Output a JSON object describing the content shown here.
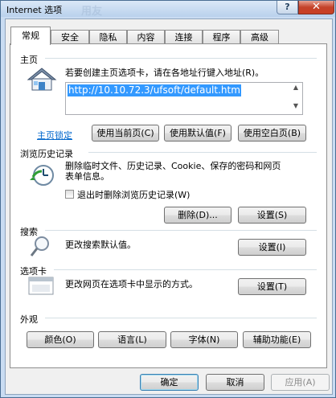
{
  "window": {
    "title": "Internet 选项",
    "ghost_logo": "用友"
  },
  "tabs": [
    "常规",
    "安全",
    "隐私",
    "内容",
    "连接",
    "程序",
    "高级"
  ],
  "homepage": {
    "title": "主页",
    "description": "若要创建主页选项卡，请在各地址行键入地址(R)。",
    "url": "http://10.10.72.3/ufsoft/default.htm",
    "lock_link": "主页锁定",
    "use_current": "使用当前页(C)",
    "use_default": "使用默认值(F)",
    "use_blank": "使用空白页(B)"
  },
  "history": {
    "title": "浏览历史记录",
    "description": "删除临时文件、历史记录、Cookie、保存的密码和网页表单信息。",
    "delete_on_exit": "退出时删除浏览历史记录(W)",
    "delete_button": "删除(D)...",
    "settings_button": "设置(S)"
  },
  "search": {
    "title": "搜索",
    "description": "更改搜索默认值。",
    "settings_button": "设置(I)"
  },
  "tabs_section": {
    "title": "选项卡",
    "description": "更改网页在选项卡中显示的方式。",
    "settings_button": "设置(T)"
  },
  "appearance": {
    "title": "外观",
    "colors": "颜色(O)",
    "languages": "语言(L)",
    "fonts": "字体(N)",
    "accessibility": "辅助功能(E)"
  },
  "footer": {
    "ok": "确定",
    "cancel": "取消",
    "apply": "应用(A)"
  },
  "colors": {
    "link": "#0066cc",
    "selection": "#3399ff",
    "close_button": "#c93f24"
  }
}
